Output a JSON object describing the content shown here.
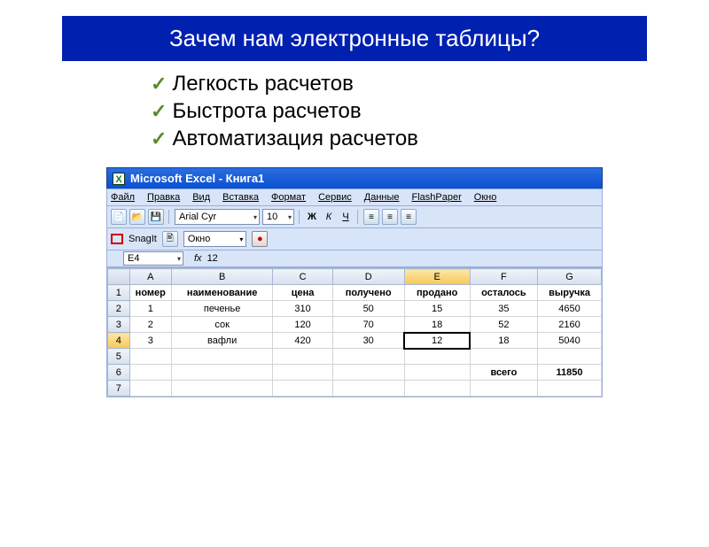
{
  "title": "Зачем нам электронные таблицы?",
  "bullets": [
    "Легкость расчетов",
    "Быстрота расчетов",
    "Автоматизация расчетов"
  ],
  "excel": {
    "app_title": "Microsoft Excel - Книга1",
    "menu": [
      "Файл",
      "Правка",
      "Вид",
      "Вставка",
      "Формат",
      "Сервис",
      "Данные",
      "FlashPaper",
      "Окно"
    ],
    "font_name": "Arial Cyr",
    "font_size": "10",
    "bold": "Ж",
    "italic": "К",
    "underline": "Ч",
    "snagit_label": "SnagIt",
    "snagit_window": "Окно",
    "name_box": "E4",
    "fx_label": "fx",
    "formula_value": "12",
    "col_headers": [
      "A",
      "B",
      "C",
      "D",
      "E",
      "F",
      "G"
    ],
    "row_headers": [
      "1",
      "2",
      "3",
      "4",
      "5",
      "6",
      "7"
    ],
    "header_row": [
      "номер",
      "наименование",
      "цена",
      "получено",
      "продано",
      "осталось",
      "выручка"
    ],
    "rows": [
      [
        "1",
        "печенье",
        "310",
        "50",
        "15",
        "35",
        "4650"
      ],
      [
        "2",
        "сок",
        "120",
        "70",
        "18",
        "52",
        "2160"
      ],
      [
        "3",
        "вафли",
        "420",
        "30",
        "12",
        "18",
        "5040"
      ]
    ],
    "total_label": "всего",
    "total_value": "11850"
  }
}
